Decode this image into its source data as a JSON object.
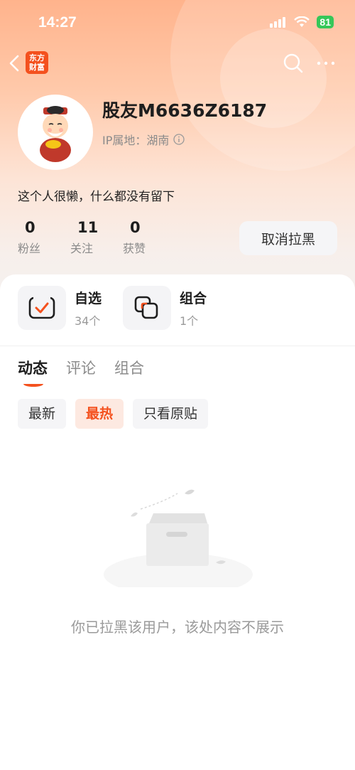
{
  "status_bar": {
    "time": "14:27",
    "battery": "81"
  },
  "nav": {
    "logo_text_line1": "东方",
    "logo_text_line2": "财富"
  },
  "profile": {
    "username": "股友M6636Z6187",
    "ip_location": "IP属地：湖南",
    "bio": "这个人很懒，什么都没有留下",
    "stats": [
      {
        "value": "0",
        "label": "粉丝"
      },
      {
        "value": "11",
        "label": "关注"
      },
      {
        "value": "0",
        "label": "获赞"
      }
    ],
    "unblock_label": "取消拉黑"
  },
  "collections": [
    {
      "title": "自选",
      "count": "34个"
    },
    {
      "title": "组合",
      "count": "1个"
    }
  ],
  "tabs": [
    {
      "label": "动态",
      "active": true
    },
    {
      "label": "评论",
      "active": false
    },
    {
      "label": "组合",
      "active": false
    }
  ],
  "filters": [
    {
      "label": "最新",
      "active": false
    },
    {
      "label": "最热",
      "active": true
    },
    {
      "label": "只看原贴",
      "active": false
    }
  ],
  "empty_state": {
    "message": "你已拉黑该用户，该处内容不展示"
  },
  "colors": {
    "accent": "#f4511e",
    "gradient_top": "#ffb38c"
  }
}
